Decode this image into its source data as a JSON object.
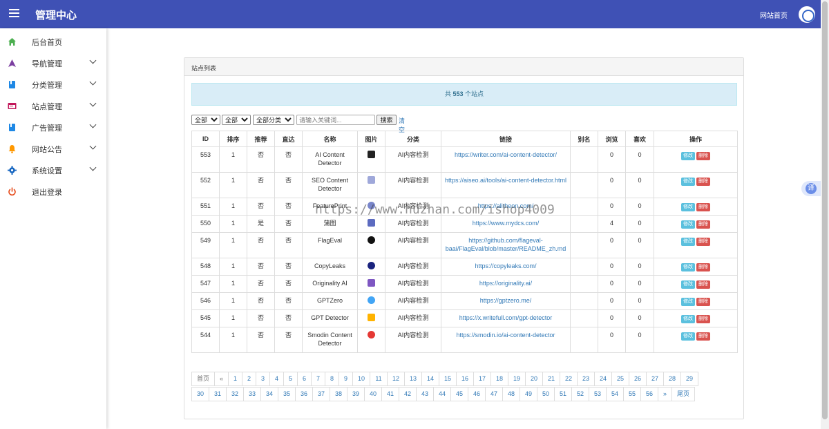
{
  "header": {
    "title": "管理中心",
    "site_home": "网站首页",
    "brand_color": "#3f51b5"
  },
  "sidebar": {
    "items": [
      {
        "label": "后台首页",
        "icon": "home-icon",
        "color": "#4caf50",
        "expandable": false
      },
      {
        "label": "导航管理",
        "icon": "navigation-arrow-icon",
        "color": "#7b3fa0",
        "expandable": true
      },
      {
        "label": "分类管理",
        "icon": "bookmark-icon",
        "color": "#1e88e5",
        "expandable": true
      },
      {
        "label": "站点管理",
        "icon": "window-icon",
        "color": "#c2185b",
        "expandable": true
      },
      {
        "label": "广告管理",
        "icon": "bookmark-icon",
        "color": "#1e88e5",
        "expandable": true
      },
      {
        "label": "网站公告",
        "icon": "bell-icon",
        "color": "#ff9800",
        "expandable": true
      },
      {
        "label": "系统设置",
        "icon": "gear-icon",
        "color": "#1565c0",
        "expandable": true
      },
      {
        "label": "退出登录",
        "icon": "power-icon",
        "color": "#e64a19",
        "expandable": false
      }
    ]
  },
  "panel": {
    "title": "站点列表",
    "summary_prefix": "共",
    "summary_count": "553",
    "summary_suffix": "个站点"
  },
  "filters": {
    "select1": "全部",
    "select2": "全部",
    "select3": "全部分类",
    "search_placeholder": "请输入关键词...",
    "search_button": "搜索",
    "clear_link": "清空"
  },
  "table": {
    "headers": [
      "ID",
      "排序",
      "推荐",
      "直达",
      "名称",
      "图片",
      "分类",
      "链接",
      "别名",
      "浏览",
      "喜欢",
      "操作"
    ],
    "edit_label": "修改",
    "delete_label": "删除",
    "rows": [
      {
        "id": "553",
        "sort": "1",
        "recommend": "否",
        "direct": "否",
        "name": "AI Content Detector",
        "icon": "writer-logo-icon",
        "icon_color": "#222222",
        "category": "AI内容检测",
        "link": "https://writer.com/ai-content-detector/",
        "alias": "",
        "views": "0",
        "likes": "0"
      },
      {
        "id": "552",
        "sort": "1",
        "recommend": "否",
        "direct": "否",
        "name": "SEO Content Detector",
        "icon": "aiseo-logo-icon",
        "icon_color": "#9fa8da",
        "category": "AI内容检测",
        "link": "https://aiseo.ai/tools/ai-content-detector.html",
        "alias": "",
        "views": "0",
        "likes": "0"
      },
      {
        "id": "551",
        "sort": "1",
        "recommend": "否",
        "direct": "否",
        "name": "FeaturePrint",
        "icon": "featureprint-logo-icon",
        "icon_color": "#7986cb",
        "category": "AI内容检测",
        "link": "https://alitheon.com/",
        "alias": "",
        "views": "0",
        "likes": "0"
      },
      {
        "id": "550",
        "sort": "1",
        "recommend": "是",
        "direct": "否",
        "name": "蒲图",
        "icon": "mydcs-logo-icon",
        "icon_color": "#5c6bc0",
        "category": "AI内容检测",
        "link": "https://www.mydcs.com/",
        "alias": "",
        "views": "4",
        "likes": "0"
      },
      {
        "id": "549",
        "sort": "1",
        "recommend": "否",
        "direct": "否",
        "name": "FlagEval",
        "icon": "github-logo-icon",
        "icon_color": "#111111",
        "category": "AI内容检测",
        "link": "https://github.com/flageval-baai/FlagEval/blob/master/README_zh.md",
        "alias": "",
        "views": "0",
        "likes": "0"
      },
      {
        "id": "548",
        "sort": "1",
        "recommend": "否",
        "direct": "否",
        "name": "CopyLeaks",
        "icon": "copyleaks-logo-icon",
        "icon_color": "#1a237e",
        "category": "AI内容检测",
        "link": "https://copyleaks.com/",
        "alias": "",
        "views": "0",
        "likes": "0"
      },
      {
        "id": "547",
        "sort": "1",
        "recommend": "否",
        "direct": "否",
        "name": "Originality AI",
        "icon": "originality-logo-icon",
        "icon_color": "#7e57c2",
        "category": "AI内容检测",
        "link": "https://originality.ai/",
        "alias": "",
        "views": "0",
        "likes": "0"
      },
      {
        "id": "546",
        "sort": "1",
        "recommend": "否",
        "direct": "否",
        "name": "GPTZero",
        "icon": "gptzero-logo-icon",
        "icon_color": "#42a5f5",
        "category": "AI内容检测",
        "link": "https://gptzero.me/",
        "alias": "",
        "views": "0",
        "likes": "0"
      },
      {
        "id": "545",
        "sort": "1",
        "recommend": "否",
        "direct": "否",
        "name": "GPT Detector",
        "icon": "writefull-logo-icon",
        "icon_color": "#ffb300",
        "category": "AI内容检测",
        "link": "https://x.writefull.com/gpt-detector",
        "alias": "",
        "views": "0",
        "likes": "0"
      },
      {
        "id": "544",
        "sort": "1",
        "recommend": "否",
        "direct": "否",
        "name": "Smodin Content Detector",
        "icon": "smodin-logo-icon",
        "icon_color": "#e53935",
        "category": "AI内容检测",
        "link": "https://smodin.io/ai-content-detector",
        "alias": "",
        "views": "0",
        "likes": "0"
      }
    ]
  },
  "pagination": {
    "row1": [
      "首页",
      "«",
      "1",
      "2",
      "3",
      "4",
      "5",
      "6",
      "7",
      "8",
      "9",
      "10",
      "11",
      "12",
      "13",
      "14",
      "15",
      "16",
      "17",
      "18",
      "19",
      "20",
      "21",
      "22",
      "23",
      "24",
      "25",
      "26",
      "27",
      "28",
      "29"
    ],
    "row2": [
      "30",
      "31",
      "32",
      "33",
      "34",
      "35",
      "36",
      "37",
      "38",
      "39",
      "40",
      "41",
      "42",
      "43",
      "44",
      "45",
      "46",
      "47",
      "48",
      "49",
      "50",
      "51",
      "52",
      "53",
      "54",
      "55",
      "56",
      "»",
      "尾页"
    ]
  },
  "watermark": "https://www.huzhan.com/ishop4009",
  "translate_button": "译"
}
